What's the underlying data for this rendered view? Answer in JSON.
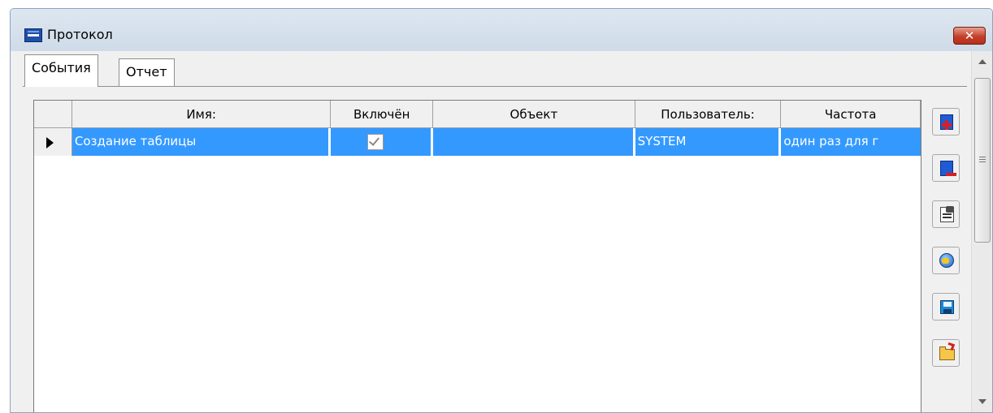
{
  "window": {
    "title": "Протокол",
    "close_label": "✕"
  },
  "tabs": [
    {
      "label": "События",
      "active": true
    },
    {
      "label": "Отчет",
      "active": false
    }
  ],
  "grid": {
    "columns": [
      "",
      "Имя:",
      "Включён",
      "Объект",
      "Пользователь:",
      "Частота"
    ],
    "rows": [
      {
        "selected": true,
        "name": "Создание таблицы",
        "enabled": true,
        "object": "",
        "user": "SYSTEM",
        "frequency": "один раз для г"
      }
    ]
  },
  "toolbar": {
    "buttons": [
      {
        "icon": "add-record-icon"
      },
      {
        "icon": "delete-record-icon"
      },
      {
        "icon": "properties-icon"
      },
      {
        "icon": "refresh-globe-icon"
      },
      {
        "icon": "save-icon"
      },
      {
        "icon": "open-folder-icon"
      }
    ]
  },
  "colors": {
    "selection": "#3399ff",
    "window_bg": "#f0f0f0",
    "titlebar": "#dde7f1",
    "close": "#c4402b"
  }
}
